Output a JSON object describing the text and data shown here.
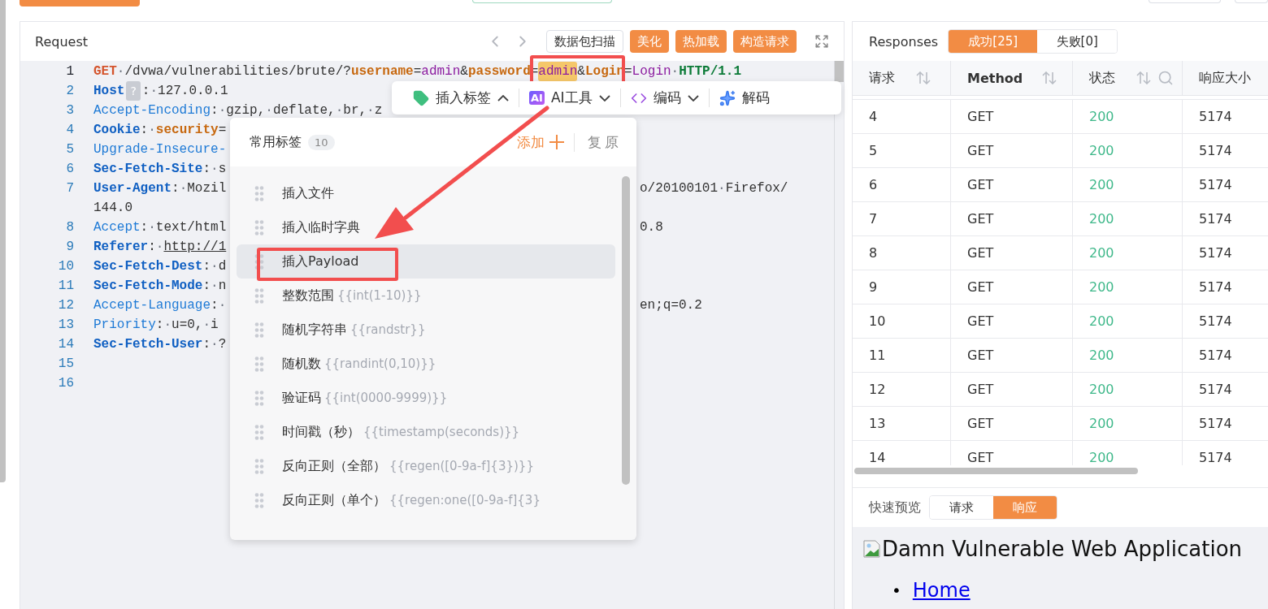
{
  "request": {
    "title": "Request",
    "buttons": [
      {
        "kind": "outline",
        "label": "数据包扫描"
      },
      {
        "kind": "primary",
        "label": "美化"
      },
      {
        "kind": "primary",
        "label": "热加载"
      },
      {
        "kind": "primary",
        "label": "构造请求"
      }
    ],
    "lines": [
      {
        "number": "1",
        "current": true,
        "tokens": [
          {
            "kind": "method",
            "text": "GET"
          },
          {
            "kind": "space",
            "text": "·"
          },
          {
            "kind": "text",
            "text": "/dvwa/vulnerabilities/brute/?"
          },
          {
            "kind": "param",
            "text": "username"
          },
          {
            "kind": "text",
            "text": "="
          },
          {
            "kind": "value",
            "text": "admin"
          },
          {
            "kind": "text",
            "text": "&"
          },
          {
            "kind": "param",
            "text": "password"
          },
          {
            "kind": "text",
            "text": "="
          },
          {
            "kind": "match",
            "text": "admin"
          },
          {
            "kind": "text",
            "text": "&"
          },
          {
            "kind": "param",
            "text": "Login"
          },
          {
            "kind": "text",
            "text": "="
          },
          {
            "kind": "value",
            "text": "Login"
          },
          {
            "kind": "space",
            "text": "·"
          },
          {
            "kind": "proto",
            "text": "HTTP/1.1"
          }
        ]
      },
      {
        "number": "2",
        "current": false,
        "tokens": [
          {
            "kind": "key-strong",
            "text": "Host"
          },
          {
            "kind": "hint",
            "text": "?"
          },
          {
            "kind": "text",
            "text": ":"
          },
          {
            "kind": "space",
            "text": "·"
          },
          {
            "kind": "text",
            "text": "127.0.0.1"
          }
        ]
      },
      {
        "number": "3",
        "current": false,
        "tokens": [
          {
            "kind": "key",
            "text": "Accept-Encoding"
          },
          {
            "kind": "text",
            "text": ":"
          },
          {
            "kind": "space",
            "text": "·"
          },
          {
            "kind": "text",
            "text": "gzip,"
          },
          {
            "kind": "space",
            "text": "·"
          },
          {
            "kind": "text",
            "text": "deflate,"
          },
          {
            "kind": "space",
            "text": "·"
          },
          {
            "kind": "text",
            "text": "br,"
          },
          {
            "kind": "space",
            "text": "·"
          },
          {
            "kind": "text",
            "text": "z"
          }
        ]
      },
      {
        "number": "4",
        "current": false,
        "tokens": [
          {
            "kind": "key-strong",
            "text": "Cookie"
          },
          {
            "kind": "text",
            "text": ":"
          },
          {
            "kind": "space",
            "text": "·"
          },
          {
            "kind": "param",
            "text": "security"
          },
          {
            "kind": "text",
            "text": "="
          }
        ]
      },
      {
        "number": "5",
        "current": false,
        "tokens": [
          {
            "kind": "key",
            "text": "Upgrade-Insecure-"
          }
        ]
      },
      {
        "number": "6",
        "current": false,
        "tokens": [
          {
            "kind": "key-strong",
            "text": "Sec-Fetch-Site"
          },
          {
            "kind": "text",
            "text": ":"
          },
          {
            "kind": "space",
            "text": "·"
          },
          {
            "kind": "text",
            "text": "s"
          }
        ]
      },
      {
        "number": "7",
        "current": false,
        "tokens": [
          {
            "kind": "key-strong",
            "text": "User-Agent"
          },
          {
            "kind": "text",
            "text": ":"
          },
          {
            "kind": "space",
            "text": "·"
          },
          {
            "kind": "text",
            "text": "Mozil"
          }
        ],
        "tail": [
          {
            "kind": "text",
            "text": "o/20100101"
          },
          {
            "kind": "space",
            "text": "·"
          },
          {
            "kind": "text",
            "text": "Firefox/"
          }
        ]
      },
      {
        "tokens": [
          {
            "kind": "text",
            "text": "144.0"
          }
        ]
      },
      {
        "number": "8",
        "current": false,
        "tokens": [
          {
            "kind": "key",
            "text": "Accept"
          },
          {
            "kind": "text",
            "text": ":"
          },
          {
            "kind": "space",
            "text": "·"
          },
          {
            "kind": "text",
            "text": "text/html"
          }
        ],
        "tail": [
          {
            "kind": "text",
            "text": "0.8"
          }
        ]
      },
      {
        "number": "9",
        "current": false,
        "tokens": [
          {
            "kind": "key-strong",
            "text": "Referer"
          },
          {
            "kind": "text",
            "text": ":"
          },
          {
            "kind": "space",
            "text": "·"
          },
          {
            "kind": "link",
            "text": "http://1"
          }
        ]
      },
      {
        "number": "10",
        "current": false,
        "tokens": [
          {
            "kind": "key-strong",
            "text": "Sec-Fetch-Dest"
          },
          {
            "kind": "text",
            "text": ":"
          },
          {
            "kind": "space",
            "text": "·"
          },
          {
            "kind": "text",
            "text": "d"
          }
        ]
      },
      {
        "number": "11",
        "current": false,
        "tokens": [
          {
            "kind": "key-strong",
            "text": "Sec-Fetch-Mode"
          },
          {
            "kind": "text",
            "text": ":"
          },
          {
            "kind": "space",
            "text": "·"
          },
          {
            "kind": "text",
            "text": "n"
          }
        ]
      },
      {
        "number": "12",
        "current": false,
        "tokens": [
          {
            "kind": "key",
            "text": "Accept-Language"
          },
          {
            "kind": "text",
            "text": ":"
          },
          {
            "kind": "space",
            "text": "·"
          }
        ],
        "tail": [
          {
            "kind": "text",
            "text": "en;q=0.2"
          }
        ]
      },
      {
        "number": "13",
        "current": false,
        "tokens": [
          {
            "kind": "key",
            "text": "Priority"
          },
          {
            "kind": "text",
            "text": ":"
          },
          {
            "kind": "space",
            "text": "·"
          },
          {
            "kind": "text",
            "text": "u=0,"
          },
          {
            "kind": "space",
            "text": "·"
          },
          {
            "kind": "text",
            "text": "i"
          }
        ]
      },
      {
        "number": "14",
        "current": false,
        "tokens": [
          {
            "kind": "key-strong",
            "text": "Sec-Fetch-User"
          },
          {
            "kind": "text",
            "text": ":"
          },
          {
            "kind": "space",
            "text": "·"
          },
          {
            "kind": "text",
            "text": "?"
          }
        ]
      },
      {
        "number": "15",
        "current": false
      },
      {
        "number": "16",
        "current": false
      }
    ]
  },
  "insert_toolbar": [
    {
      "kind": "tag",
      "label": "插入标签",
      "expanded": true
    },
    {
      "kind": "ai",
      "badge": "AI",
      "label": "AI工具",
      "expanded": false
    },
    {
      "kind": "code",
      "label": "编码",
      "expanded": false
    },
    {
      "kind": "sparkle",
      "label": "解码"
    }
  ],
  "tag_menu": {
    "title": "常用标签",
    "count": "10",
    "add": "添加",
    "reset": "复原",
    "items": [
      {
        "label": "插入文件",
        "selected": false
      },
      {
        "label": "插入临时字典",
        "selected": false
      },
      {
        "label": "插入Payload",
        "selected": true
      },
      {
        "label": "整数范围",
        "template": "{{int(1-10)}}",
        "selected": false
      },
      {
        "label": "随机字符串",
        "template": "{{randstr}}",
        "selected": false
      },
      {
        "label": "随机数",
        "template": "{{randint(0,10)}}",
        "selected": false
      },
      {
        "label": "验证码",
        "template": "{{int(0000-9999)}}",
        "selected": false
      },
      {
        "label": "时间戳（秒）",
        "template": "{{timestamp(seconds)}}",
        "selected": false
      },
      {
        "label": "反向正则（全部）",
        "template": "{{regen([0-9a-f]{3})}}",
        "selected": false
      },
      {
        "label": "反向正则（单个）",
        "template": "{{regen:one([0-9a-f]{3}",
        "selected": false
      }
    ]
  },
  "responses": {
    "title": "Responses",
    "tabs": [
      {
        "label": "成功[25]",
        "selected": true
      },
      {
        "label": "失败[0]",
        "selected": false
      }
    ],
    "columns": [
      {
        "label": "请求",
        "sortable": true,
        "searchable": false
      },
      {
        "label": "Method",
        "sortable": true,
        "searchable": false
      },
      {
        "label": "状态",
        "sortable": true,
        "searchable": true
      },
      {
        "label": "响应大小",
        "sortable": false,
        "searchable": false
      }
    ],
    "rows": [
      [
        "4",
        "GET",
        "200",
        "5174"
      ],
      [
        "5",
        "GET",
        "200",
        "5174"
      ],
      [
        "6",
        "GET",
        "200",
        "5174"
      ],
      [
        "7",
        "GET",
        "200",
        "5174"
      ],
      [
        "8",
        "GET",
        "200",
        "5174"
      ],
      [
        "9",
        "GET",
        "200",
        "5174"
      ],
      [
        "10",
        "GET",
        "200",
        "5174"
      ],
      [
        "11",
        "GET",
        "200",
        "5174"
      ],
      [
        "12",
        "GET",
        "200",
        "5174"
      ],
      [
        "13",
        "GET",
        "200",
        "5174"
      ],
      [
        "14",
        "GET",
        "200",
        "5174"
      ]
    ],
    "preview": {
      "label": "快速预览",
      "tabs": [
        {
          "label": "请求",
          "selected": false
        },
        {
          "label": "响应",
          "selected": true
        }
      ],
      "heading": "Damn Vulnerable Web Application",
      "links": [
        {
          "marker": "•",
          "label": "Home"
        }
      ]
    }
  }
}
